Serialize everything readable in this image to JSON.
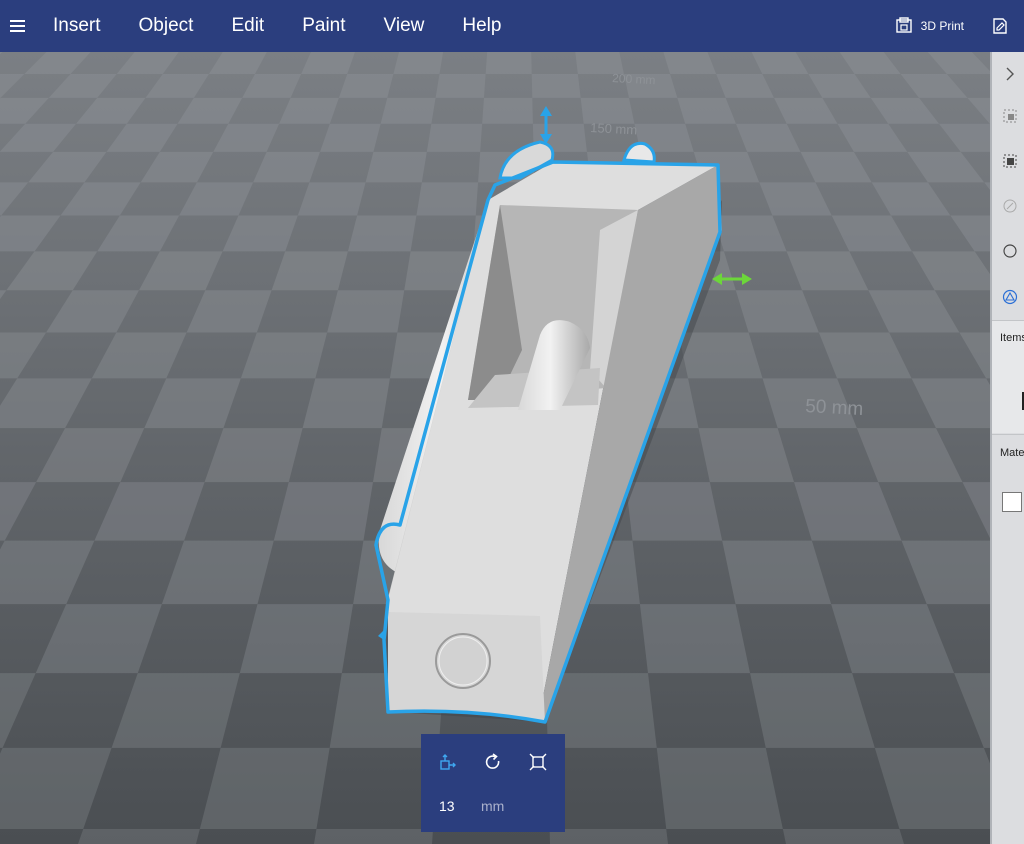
{
  "menubar": {
    "items": [
      "Insert",
      "Object",
      "Edit",
      "Paint",
      "View",
      "Help"
    ],
    "print_label": "3D Print"
  },
  "viewport": {
    "grid_labels": [
      "200 mm",
      "150 mm",
      "50 mm"
    ]
  },
  "right_panel": {
    "items_label": "Items",
    "material_label": "Mate",
    "material_swatch_color": "#ffffff"
  },
  "transform_panel": {
    "value": "13",
    "unit": "mm"
  },
  "colors": {
    "menubar": "#2b3e7e",
    "selection_outline": "#29a3e8",
    "gizmo_green": "#6cd63a"
  }
}
